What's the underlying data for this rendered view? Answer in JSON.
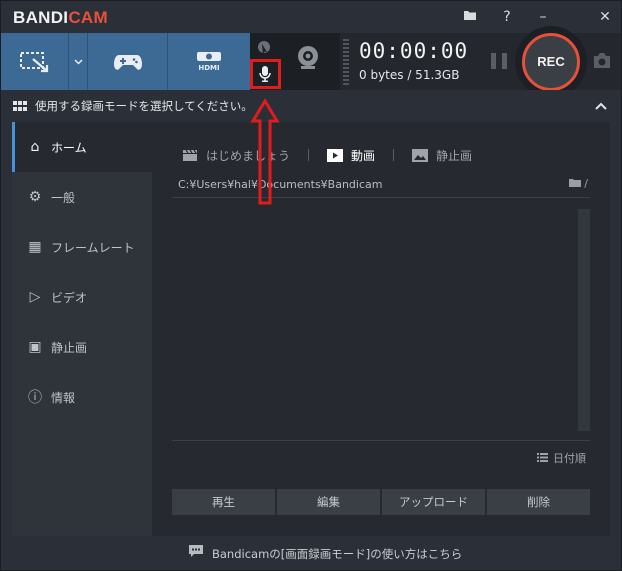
{
  "app": {
    "logo_a": "BANDI",
    "logo_b": "CAM"
  },
  "titlebar": {
    "icons": [
      "folder-icon",
      "help-icon",
      "minimize-icon",
      "close-icon"
    ],
    "help_glyph": "?",
    "minimize_glyph": "–",
    "close_glyph": "✕"
  },
  "toolbar": {
    "modes": [
      "screen-rectangle-mode",
      "game-mode",
      "hdmi-device-mode"
    ],
    "hdmi_label": "HDMI",
    "timer": "00:00:00",
    "size": "0 bytes / 51.3GB",
    "rec_label": "REC"
  },
  "subheader": {
    "text": "使用する録画モードを選択してください。"
  },
  "sidebar": {
    "items": [
      {
        "label": "ホーム",
        "icon": "home-icon",
        "glyph": "⌂",
        "active": true
      },
      {
        "label": "一般",
        "icon": "gear-icon",
        "glyph": "⚙",
        "active": false
      },
      {
        "label": "フレームレート",
        "icon": "framerate-icon",
        "glyph": "▦",
        "active": false
      },
      {
        "label": "ビデオ",
        "icon": "video-icon",
        "glyph": "▷",
        "active": false
      },
      {
        "label": "静止画",
        "icon": "image-icon",
        "glyph": "▣",
        "active": false
      },
      {
        "label": "情報",
        "icon": "info-icon",
        "glyph": "ⓘ",
        "active": false
      }
    ]
  },
  "main": {
    "tabs": [
      {
        "label": "はじめましょう",
        "icon": "clapper-icon",
        "glyph": "🎬",
        "active": false
      },
      {
        "label": "動画",
        "icon": "play-icon",
        "glyph": "▶",
        "active": true
      },
      {
        "label": "静止画",
        "icon": "picture-icon",
        "glyph": "▨",
        "active": false
      }
    ],
    "path": "C:¥Users¥hal¥Documents¥Bandicam",
    "folder_suffix": "/",
    "sort_label": "日付順",
    "actions": [
      "再生",
      "編集",
      "アップロード",
      "削除"
    ]
  },
  "footer": {
    "text": "Bandicamの[画面録画モード]の使い方はこちら"
  },
  "colors": {
    "accent": "#3d6a95",
    "rec": "#e8503a",
    "annotation": "#e21b1b"
  }
}
